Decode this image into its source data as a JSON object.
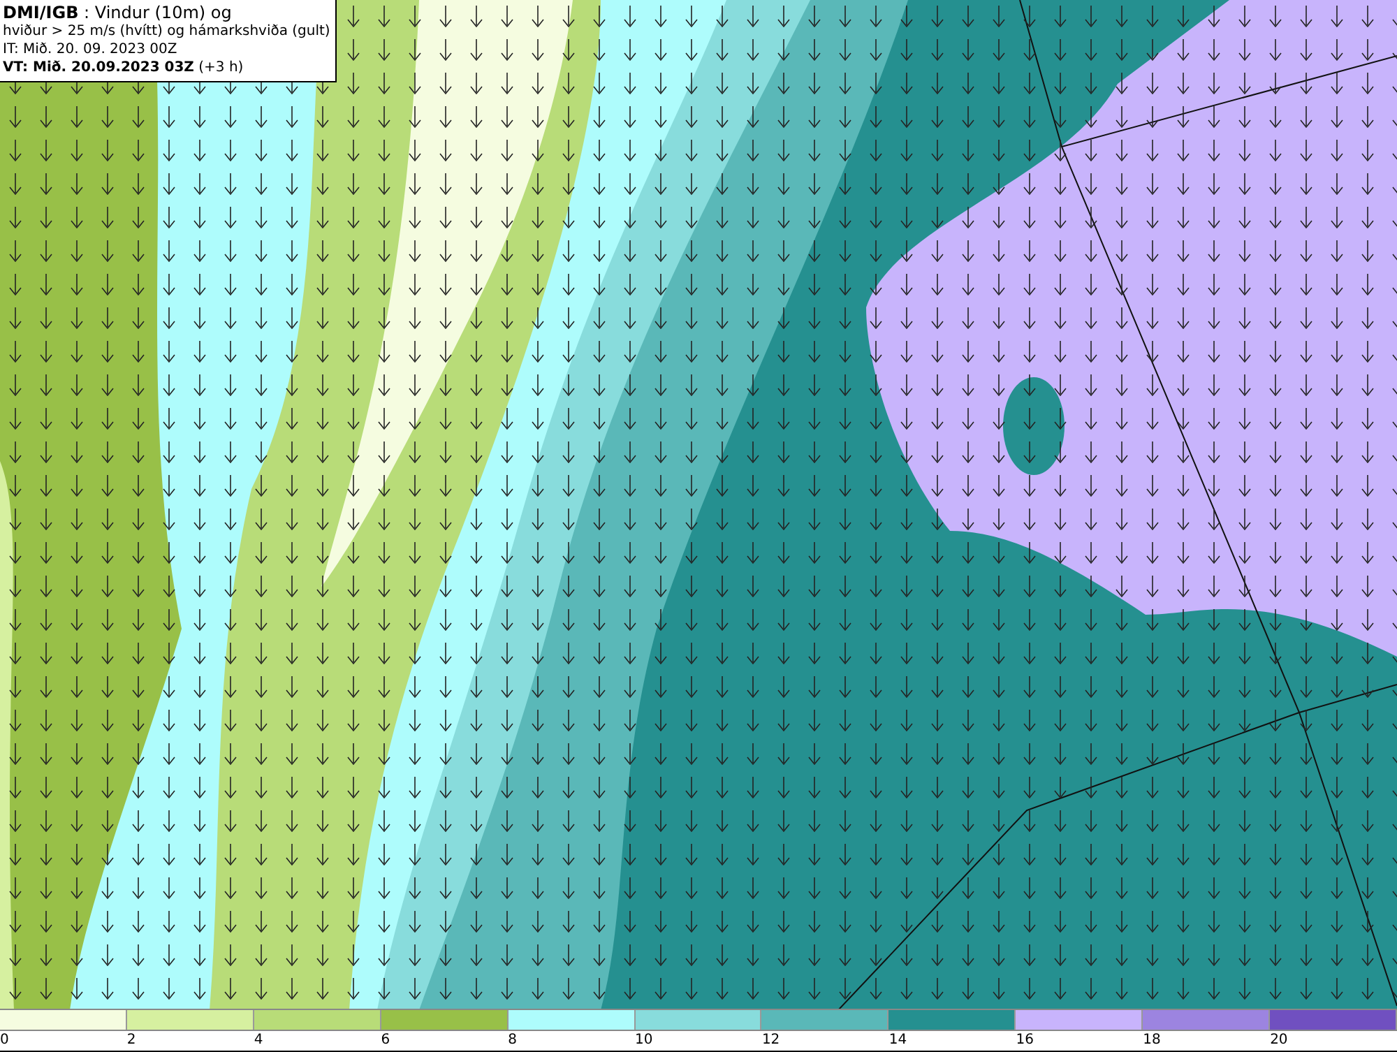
{
  "title_box": {
    "lines": [
      "**DMI/IGB** : Vindur (10m) og",
      "hviður > 25 m/s (hvítt) og hámarkshviða (gult)",
      "IT: Mið. 20. 09. 2023 00Z",
      "**VT: Mið. 20.09.2023 03Z** (+3 h)"
    ]
  },
  "legend": {
    "bins": [
      {
        "color": "#f5fce0"
      },
      {
        "color": "#d6f0a0"
      },
      {
        "color": "#b8dc78"
      },
      {
        "color": "#98c048"
      },
      {
        "color": "#aefcfc"
      },
      {
        "color": "#88dcdc"
      },
      {
        "color": "#5ab8b8"
      },
      {
        "color": "#259090"
      },
      {
        "color": "#c8b4fc"
      },
      {
        "color": "#9c84e0"
      },
      {
        "color": "#7050c0"
      }
    ],
    "ticks": [
      "0",
      "2",
      "4",
      "6",
      "8",
      "10",
      "12",
      "14",
      "16",
      "18",
      "20"
    ]
  }
}
